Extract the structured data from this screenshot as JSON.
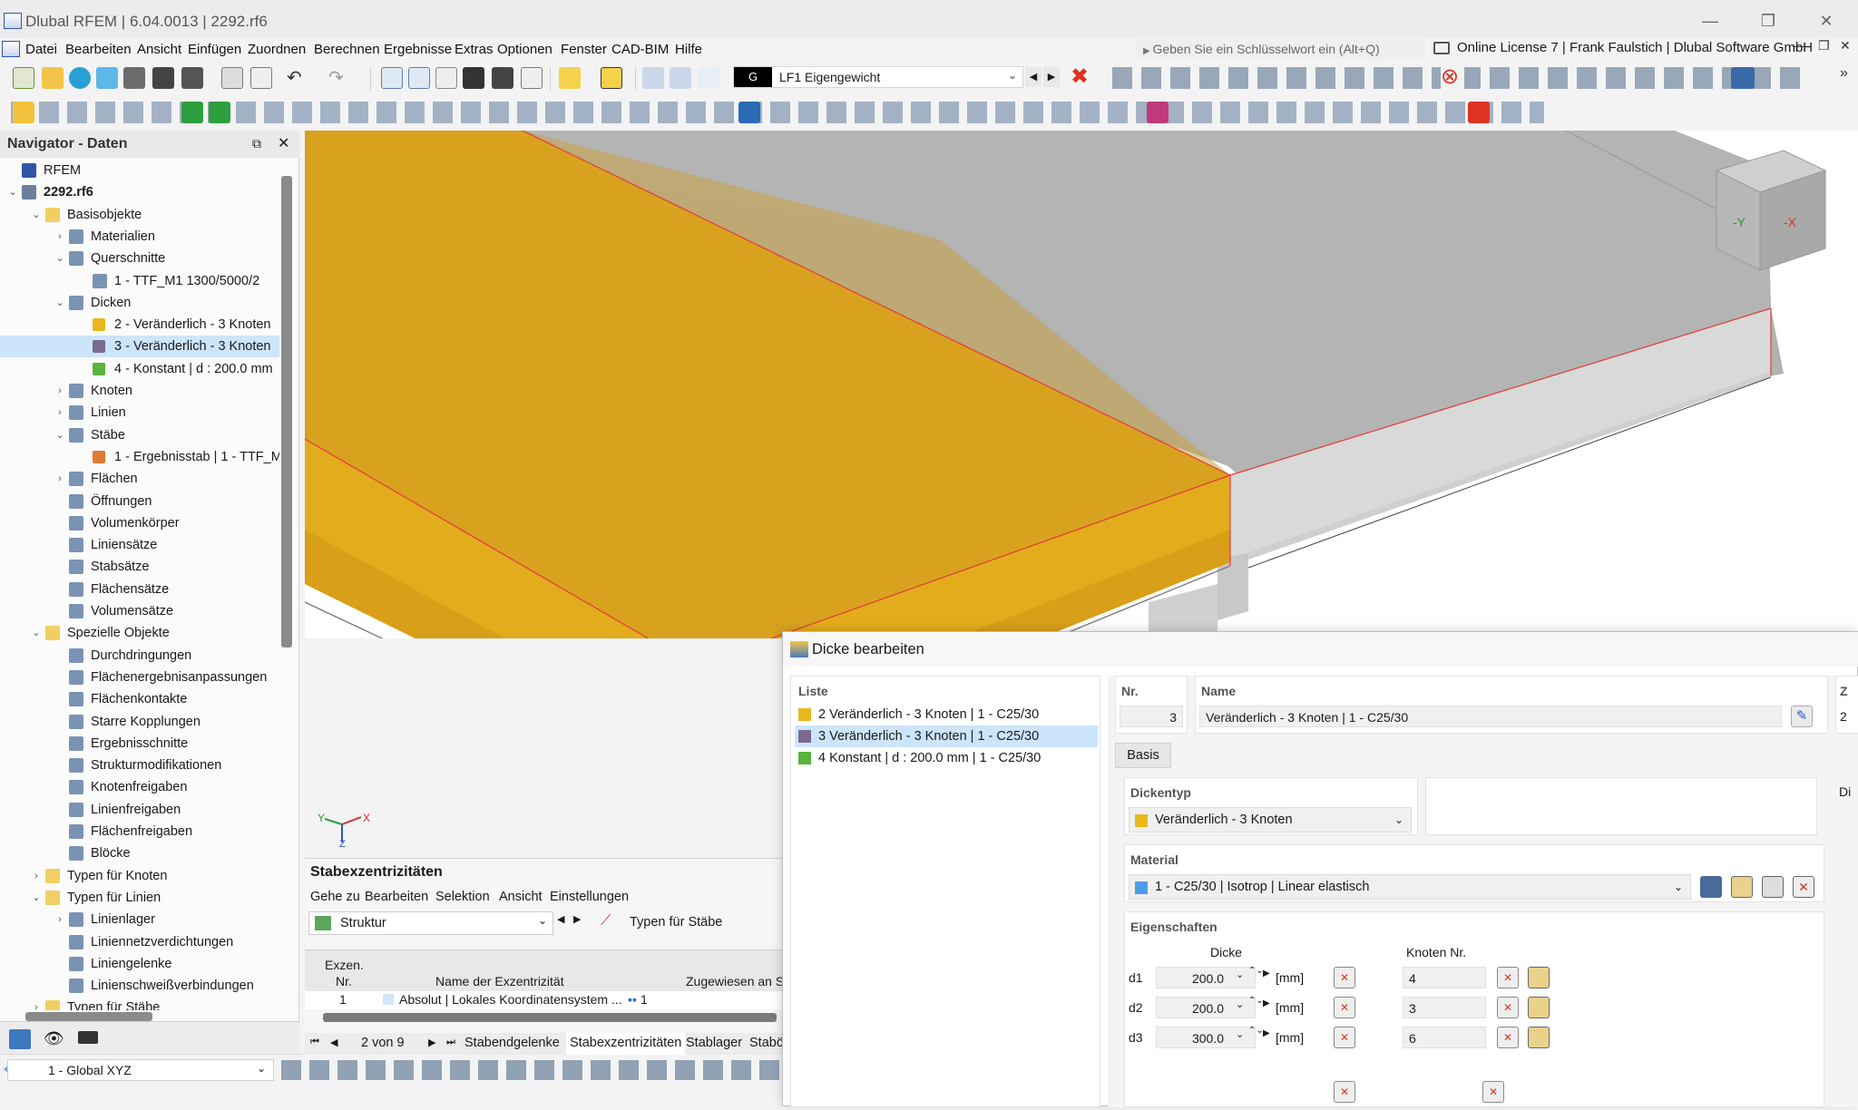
{
  "window": {
    "title": "Dlubal RFEM | 6.04.0013 | 2292.rf6",
    "minimize": "—",
    "maximize": "❐",
    "close": "✕"
  },
  "menu": {
    "items": [
      "Datei",
      "Bearbeiten",
      "Ansicht",
      "Einfügen",
      "Zuordnen",
      "Berechnen",
      "Ergebnisse",
      "Extras",
      "Optionen",
      "Fenster",
      "CAD-BIM",
      "Hilfe"
    ],
    "search_placeholder": "Geben Sie ein Schlüsselwort ein (Alt+Q)",
    "license": "Online License 7 | Frank Faulstich | Dlubal Software GmbH"
  },
  "toolbar": {
    "loadcase_tag": "G",
    "loadcase_id": "LF1",
    "loadcase_name": "Eigengewicht"
  },
  "navigator": {
    "title": "Navigator - Daten",
    "tree": [
      {
        "label": "RFEM",
        "level": 0,
        "icon": "rfem-icon"
      },
      {
        "label": "2292.rf6",
        "level": 0,
        "bold": true,
        "icon": "file-icon"
      },
      {
        "label": "Basisobjekte",
        "level": 1,
        "icon": "folder-icon"
      },
      {
        "label": "Materialien",
        "level": 2,
        "icon": "materials-icon"
      },
      {
        "label": "Querschnitte",
        "level": 2,
        "icon": "section-icon"
      },
      {
        "label": "1 - TTF_M1 1300/5000/2",
        "level": 3,
        "icon": "section-item-icon"
      },
      {
        "label": "Dicken",
        "level": 2,
        "icon": "thickness-icon"
      },
      {
        "label": "2 - Veränderlich - 3 Knoten",
        "level": 3,
        "icon": "swatch-yellow"
      },
      {
        "label": "3 - Veränderlich - 3 Knoten",
        "level": 3,
        "icon": "swatch-purple",
        "selected": true
      },
      {
        "label": "4 - Konstant | d : 200.0 mm",
        "level": 3,
        "icon": "swatch-green"
      },
      {
        "label": "Knoten",
        "level": 2,
        "icon": "node-icon"
      },
      {
        "label": "Linien",
        "level": 2,
        "icon": "line-icon"
      },
      {
        "label": "Stäbe",
        "level": 2,
        "icon": "member-icon"
      },
      {
        "label": "1 - Ergebnisstab | 1 - TTF_M",
        "level": 3,
        "icon": "swatch-orange"
      },
      {
        "label": "Flächen",
        "level": 2,
        "icon": "surface-icon"
      },
      {
        "label": "Öffnungen",
        "level": 2,
        "icon": "opening-icon"
      },
      {
        "label": "Volumenkörper",
        "level": 2,
        "icon": "solid-icon"
      },
      {
        "label": "Liniensätze",
        "level": 2,
        "icon": "lineset-icon"
      },
      {
        "label": "Stabsätze",
        "level": 2,
        "icon": "memberset-icon"
      },
      {
        "label": "Flächensätze",
        "level": 2,
        "icon": "surfaceset-icon"
      },
      {
        "label": "Volumensätze",
        "level": 2,
        "icon": "solidset-icon"
      },
      {
        "label": "Spezielle Objekte",
        "level": 1,
        "icon": "folder-icon"
      },
      {
        "label": "Durchdringungen",
        "level": 2,
        "icon": "intersection-icon"
      },
      {
        "label": "Flächenergebnisanpassungen",
        "level": 2,
        "icon": "result-adjust-icon"
      },
      {
        "label": "Flächenkontakte",
        "level": 2,
        "icon": "contact-icon"
      },
      {
        "label": "Starre Kopplungen",
        "level": 2,
        "icon": "rigid-link-icon"
      },
      {
        "label": "Ergebnisschnitte",
        "level": 2,
        "icon": "result-section-icon"
      },
      {
        "label": "Strukturmodifikationen",
        "level": 2,
        "icon": "modification-icon"
      },
      {
        "label": "Knotenfreigaben",
        "level": 2,
        "icon": "node-release-icon"
      },
      {
        "label": "Linienfreigaben",
        "level": 2,
        "icon": "line-release-icon"
      },
      {
        "label": "Flächenfreigaben",
        "level": 2,
        "icon": "surface-release-icon"
      },
      {
        "label": "Blöcke",
        "level": 2,
        "icon": "block-icon"
      },
      {
        "label": "Typen für Knoten",
        "level": 1,
        "icon": "folder-icon"
      },
      {
        "label": "Typen für Linien",
        "level": 1,
        "icon": "folder-icon"
      },
      {
        "label": "Linienlager",
        "level": 2,
        "icon": "line-support-icon"
      },
      {
        "label": "Liniennetzverdichtungen",
        "level": 2,
        "icon": "mesh-refine-icon"
      },
      {
        "label": "Liniengelenke",
        "level": 2,
        "icon": "line-hinge-icon"
      },
      {
        "label": "Linienschweißverbindungen",
        "level": 2,
        "icon": "weld-icon"
      },
      {
        "label": "Typen für Stäbe",
        "level": 1,
        "icon": "folder-icon"
      }
    ],
    "coordinate_system": "1 - Global XYZ"
  },
  "viewport": {
    "axis_y": "Y",
    "axis_x": "X",
    "axis_z": "Z",
    "cube_y": "-Y",
    "cube_x": "-X"
  },
  "colors": {
    "slab_yellow": "#d9a420",
    "slab_grey": "#b8b8b8",
    "selection_blue": "#cde5fb",
    "swatch_purple": "#7a6a8f",
    "swatch_green": "#59b43c",
    "swatch_orange": "#e07a30",
    "accent_red": "#e23a3a"
  },
  "panel": {
    "title": "Stabexzentrizitäten",
    "menu": [
      "Gehe zu",
      "Bearbeiten",
      "Selektion",
      "Ansicht",
      "Einstellungen"
    ],
    "structure": "Struktur",
    "types_label": "Typen für Stäbe",
    "col_nr_line1": "Exzen.",
    "col_nr_line2": "Nr.",
    "col_name": "Name der Exzentrizität",
    "col_assigned": "Zugewiesen an S",
    "row_nr": "1",
    "row_name": "Absolut | Lokales Koordinatensystem ...",
    "row_assigned": "1",
    "pager": "2 von 9",
    "tabs": [
      "Stabendgelenke",
      "Stabexzentrizitäten",
      "Stablager",
      "Stabö"
    ]
  },
  "dialog": {
    "title": "Dicke bearbeiten",
    "list_header": "Liste",
    "list": [
      {
        "label": "2 Veränderlich - 3 Knoten | 1 - C25/30",
        "color": "#e8b81c"
      },
      {
        "label": "3 Veränderlich - 3 Knoten | 1 - C25/30",
        "color": "#7a6a8f",
        "selected": true
      },
      {
        "label": "4 Konstant | d : 200.0 mm | 1 - C25/30",
        "color": "#59b43c"
      }
    ],
    "nr_label": "Nr.",
    "nr_value": "3",
    "name_label": "Name",
    "name_value": "Veränderlich - 3 Knoten | 1 - C25/30",
    "z_label": "Z",
    "z_value": "2",
    "tab": "Basis",
    "thickness_type_label": "Dickentyp",
    "thickness_type_value": "Veränderlich - 3 Knoten",
    "di_label": "Di",
    "material_label": "Material",
    "material_value": "1 - C25/30 | Isotrop | Linear elastisch",
    "properties_label": "Eigenschaften",
    "col_thickness": "Dicke",
    "col_node": "Knoten Nr.",
    "unit": "[mm]",
    "rows": [
      {
        "label": "d1",
        "thickness": "200.0",
        "node": "4"
      },
      {
        "label": "d2",
        "thickness": "200.0",
        "node": "3"
      },
      {
        "label": "d3",
        "thickness": "300.0",
        "node": "6"
      }
    ]
  }
}
